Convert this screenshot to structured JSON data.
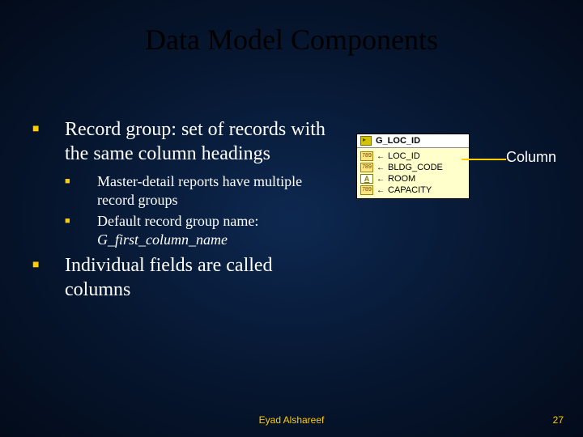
{
  "title": "Data Model Components",
  "bullets": {
    "b1": "Record group:  set of records with the same column headings",
    "b1a": "Master-detail reports have multiple record groups",
    "b1b_prefix": "Default record group name:",
    "b1b_italic": "G_first_column_name",
    "b2": "Individual fields are called columns"
  },
  "figure": {
    "header": "G_LOC_ID",
    "rows": [
      {
        "icon": "789",
        "label": "LOC_ID"
      },
      {
        "icon": "789",
        "label": "BLDG_CODE"
      },
      {
        "icon": "A",
        "label": "ROOM"
      },
      {
        "icon": "789",
        "label": "CAPACITY"
      }
    ]
  },
  "annotation": "Column",
  "footer": {
    "author": "Eyad Alshareef",
    "page": "27"
  }
}
